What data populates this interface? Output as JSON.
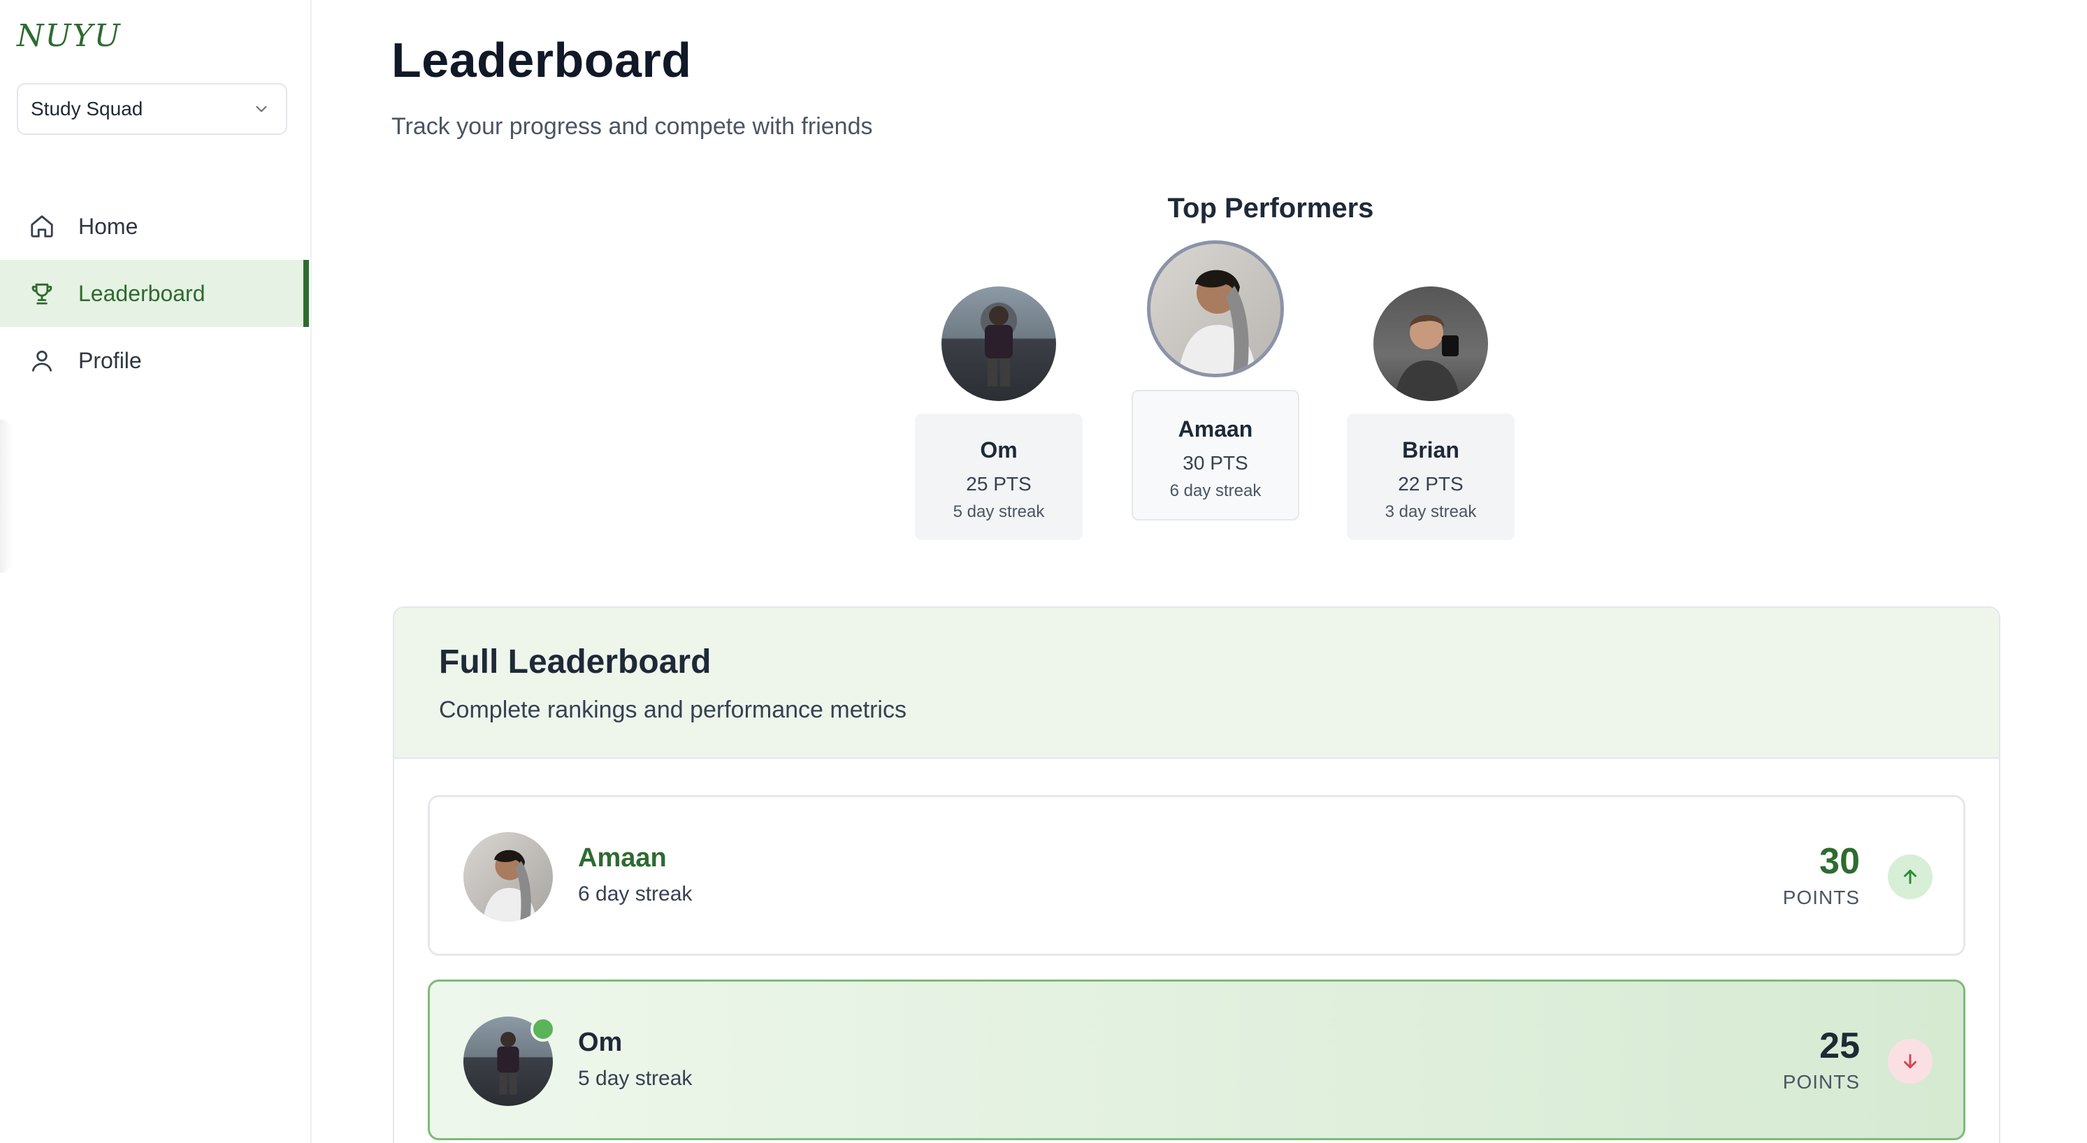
{
  "app": {
    "logo": "NUYU"
  },
  "sidebar": {
    "group_select": {
      "value": "Study Squad"
    },
    "items": [
      {
        "label": "Home",
        "icon": "home-icon",
        "active": false
      },
      {
        "label": "Leaderboard",
        "icon": "trophy-icon",
        "active": true
      },
      {
        "label": "Profile",
        "icon": "user-icon",
        "active": false
      }
    ]
  },
  "header": {
    "title": "Leaderboard",
    "subtitle": "Track your progress and compete with friends"
  },
  "top_performers": {
    "title": "Top Performers",
    "second": {
      "name": "Om",
      "points": "25 PTS",
      "streak": "5 day streak"
    },
    "first": {
      "name": "Amaan",
      "points": "30 PTS",
      "streak": "6 day streak"
    },
    "third": {
      "name": "Brian",
      "points": "22 PTS",
      "streak": "3 day streak"
    }
  },
  "full_leaderboard": {
    "title": "Full Leaderboard",
    "subtitle": "Complete rankings and performance metrics",
    "rows": [
      {
        "name": "Amaan",
        "streak": "6 day streak",
        "points": "30",
        "points_label": "POINTS",
        "trend": "up"
      },
      {
        "name": "Om",
        "streak": "5 day streak",
        "points": "25",
        "points_label": "POINTS",
        "trend": "down",
        "current_user": true
      }
    ]
  },
  "colors": {
    "brand": "#2e6b30",
    "active_bg": "#e6f2e3",
    "trend_up": "#2e8b3a",
    "trend_down": "#d64550"
  }
}
